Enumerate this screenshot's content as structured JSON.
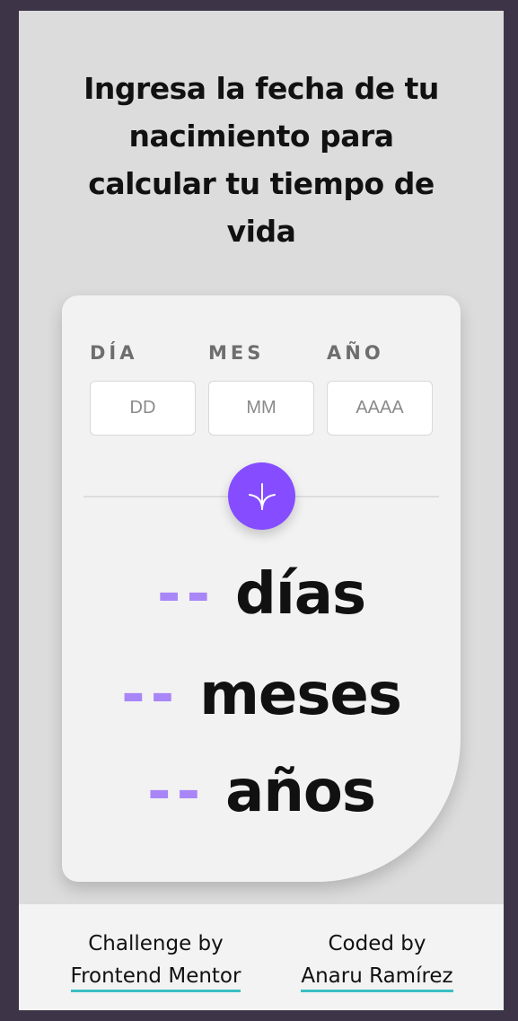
{
  "heading": {
    "lines": [
      "Ingresa la fecha de tu",
      "nacimiento para",
      "calcular tu tiempo de",
      "vida"
    ]
  },
  "form": {
    "day": {
      "label": "DÍA",
      "placeholder": "DD"
    },
    "month": {
      "label": "MES",
      "placeholder": "MM"
    },
    "year": {
      "label": "AÑO",
      "placeholder": "AAAA"
    },
    "submit_icon": "arrow-down-icon"
  },
  "results": [
    {
      "value": "--",
      "unit": "días"
    },
    {
      "value": "--",
      "unit": "meses"
    },
    {
      "value": "--",
      "unit": "años"
    }
  ],
  "footer": {
    "challenge_text": "Challenge by",
    "challenge_link": "Frontend Mentor",
    "coded_text": "Coded by",
    "coded_link": "Anaru Ramírez"
  },
  "colors": {
    "accent": "#854dff",
    "accent_light": "#a986f7",
    "link_underline": "#3bbfc4",
    "background": "#dcdcdc",
    "frame": "#3d3547"
  }
}
